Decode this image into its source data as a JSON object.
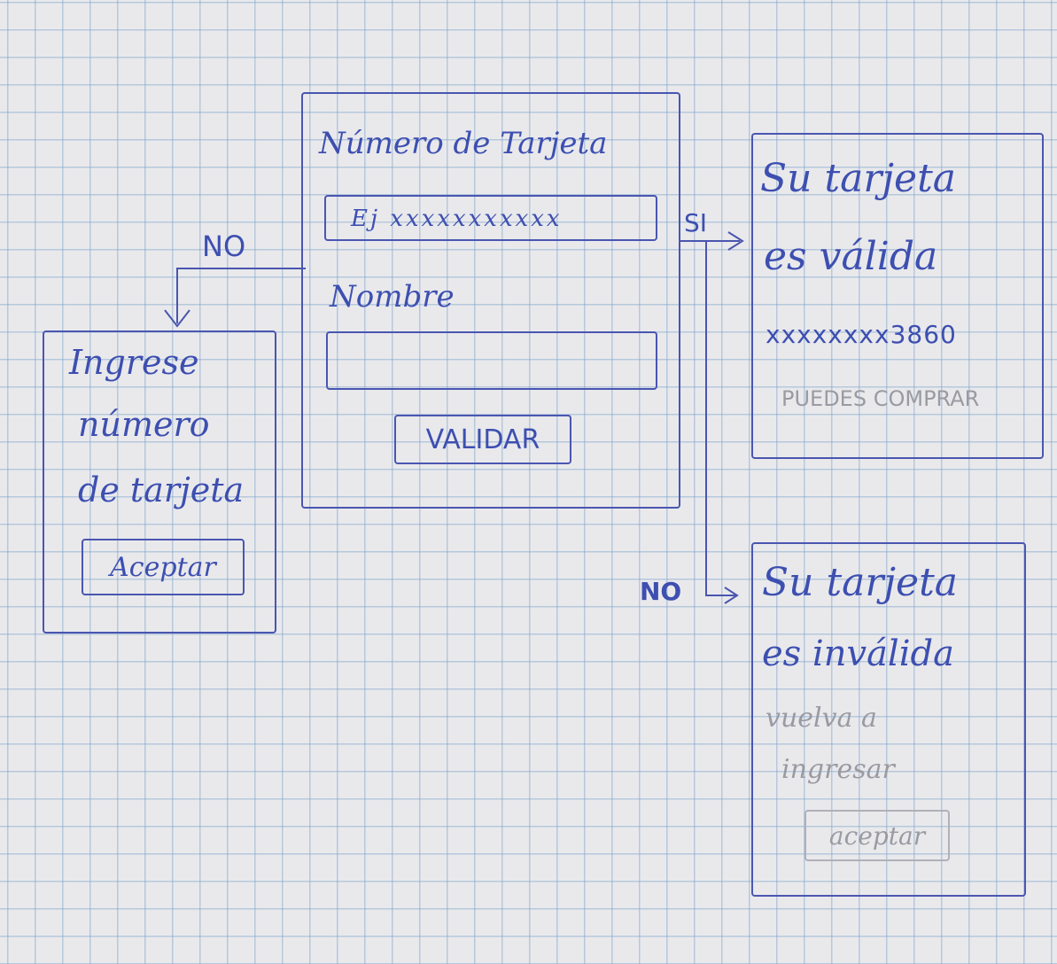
{
  "main_form": {
    "card_label": "Número de Tarjeta",
    "card_placeholder": "Ej xxxxxxxxxxx",
    "name_label": "Nombre",
    "validate_button": "VALIDAR"
  },
  "left_panel": {
    "branch_label": "NO",
    "line1": "Ingrese",
    "line2": "número",
    "line3": "de tarjeta",
    "accept_button": "Aceptar"
  },
  "valid_panel": {
    "branch_label": "SI",
    "line1": "Su tarjeta",
    "line2": "es válida",
    "masked_number": "xxxxxxxx3860",
    "message": "PUEDES COMPRAR"
  },
  "invalid_panel": {
    "branch_label": "NO",
    "line1": "Su tarjeta",
    "line2": "es inválida",
    "line3": "vuelva a",
    "line4": "ingresar",
    "accept_button": "aceptar"
  },
  "colors": {
    "ink": "#3d4fb0",
    "faint_text": "#9a9aa2",
    "paper": "#e9e9ec",
    "grid": "#78a0c8"
  }
}
